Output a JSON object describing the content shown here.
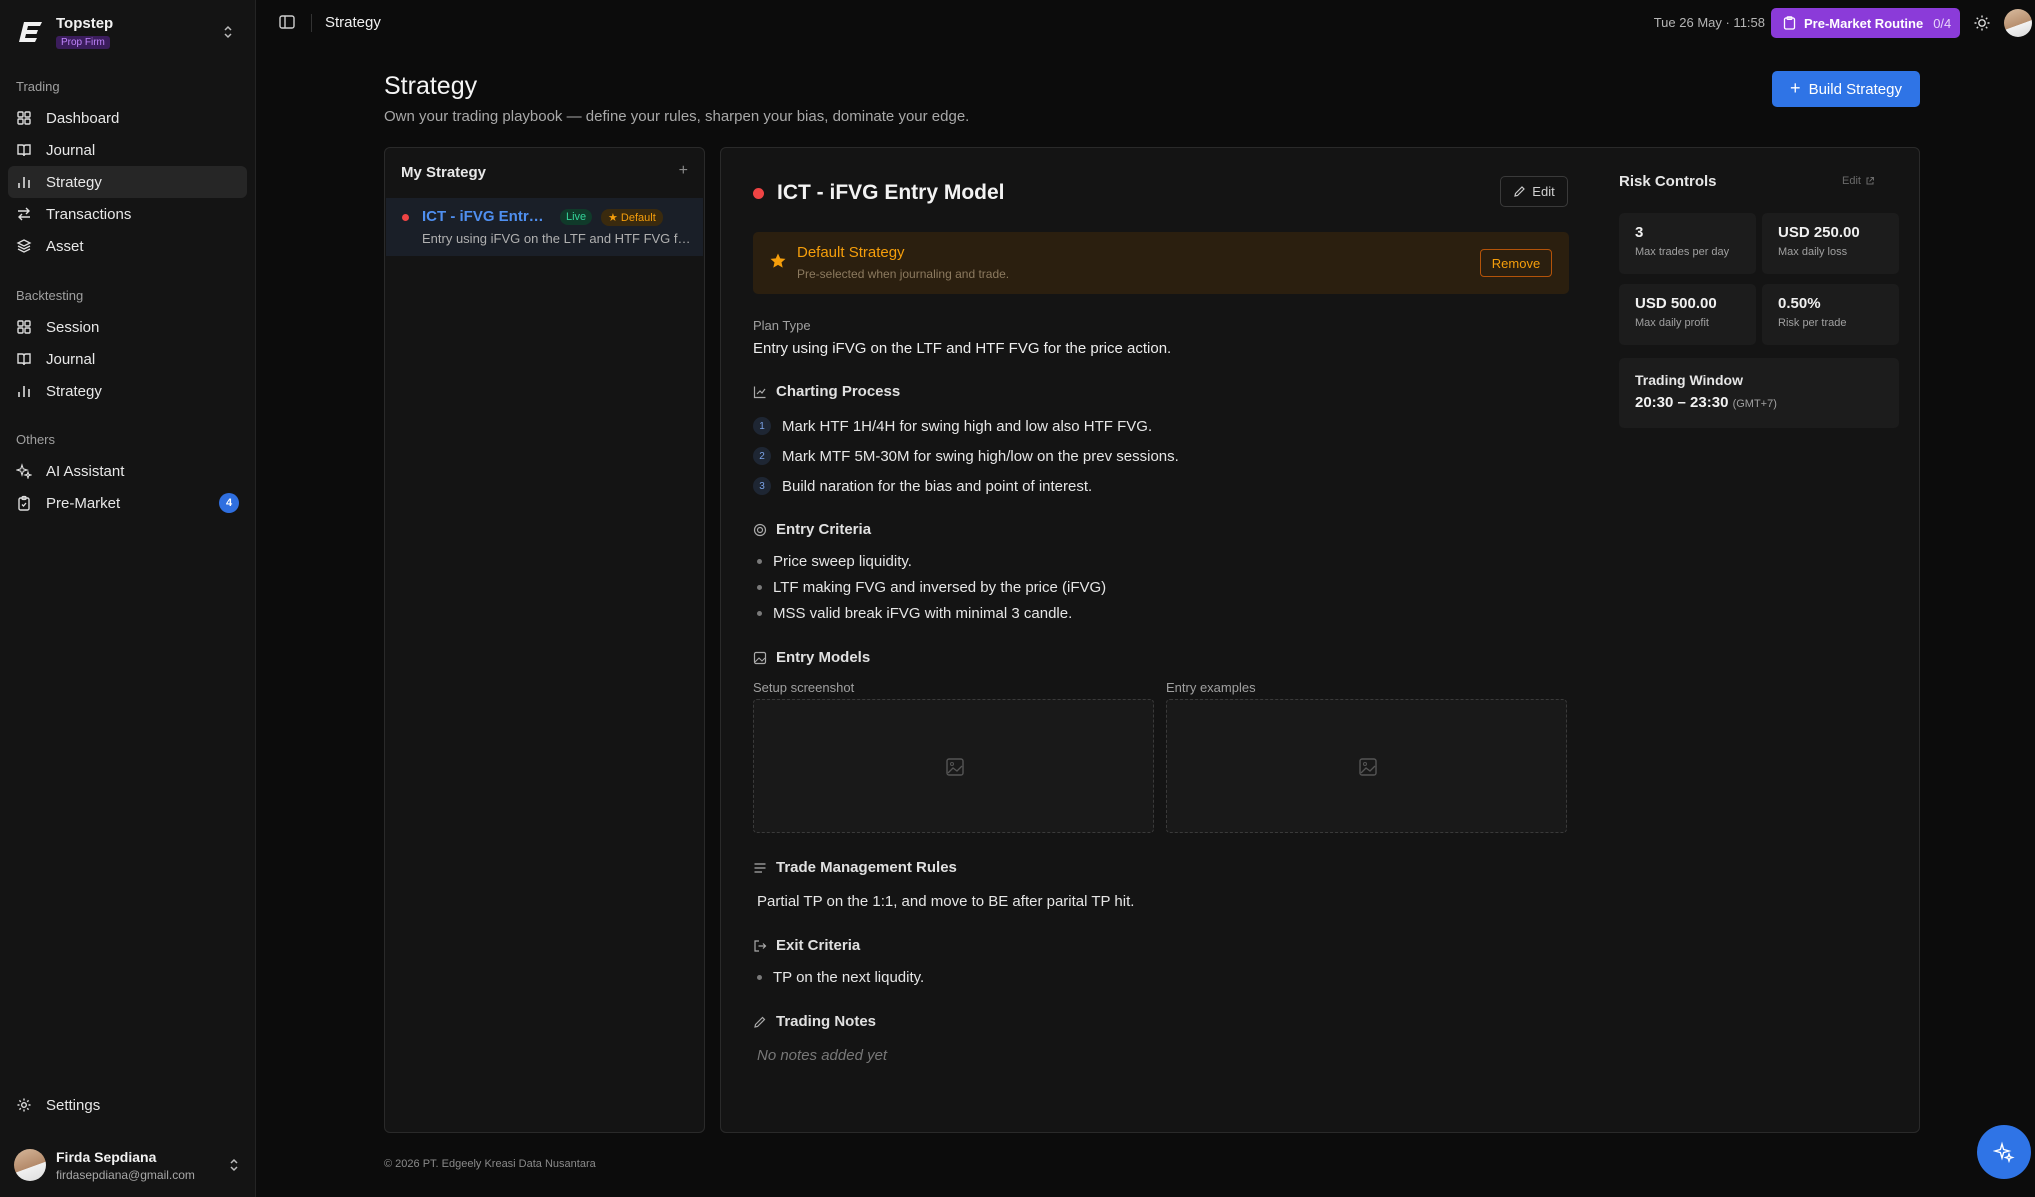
{
  "brand": {
    "name": "Topstep",
    "badge": "Prop Firm"
  },
  "sidebar": {
    "sections": [
      {
        "title": "Trading",
        "items": [
          {
            "label": "Dashboard",
            "icon": "grid-icon"
          },
          {
            "label": "Journal",
            "icon": "book-icon"
          },
          {
            "label": "Strategy",
            "icon": "bar-chart-icon",
            "active": true
          },
          {
            "label": "Transactions",
            "icon": "arrows-icon"
          },
          {
            "label": "Asset",
            "icon": "layers-icon"
          }
        ]
      },
      {
        "title": "Backtesting",
        "items": [
          {
            "label": "Session",
            "icon": "grid-icon"
          },
          {
            "label": "Journal",
            "icon": "book-icon"
          },
          {
            "label": "Strategy",
            "icon": "bar-chart-icon"
          }
        ]
      },
      {
        "title": "Others",
        "items": [
          {
            "label": "AI Assistant",
            "icon": "sparkles-icon"
          },
          {
            "label": "Pre-Market",
            "icon": "clipboard-icon",
            "count": "4"
          }
        ]
      }
    ],
    "settings_label": "Settings",
    "user": {
      "name": "Firda Sepdiana",
      "email": "firdasepdiana@gmail.com"
    }
  },
  "topbar": {
    "breadcrumb": "Strategy",
    "datetime": "Tue 26 May · 11:58",
    "routine_label": "Pre-Market Routine",
    "routine_count": "0/4"
  },
  "page": {
    "title": "Strategy",
    "subtitle": "Own your trading playbook — define your rules, sharpen your bias, dominate your edge.",
    "build_button": "Build Strategy"
  },
  "my_strategy": {
    "header": "My Strategy",
    "add": "+",
    "items": [
      {
        "title": "ICT - iFVG Entry Model",
        "live": "Live",
        "default": "Default",
        "description": "Entry using iFVG on the LTF and HTF FVG for the price action."
      }
    ]
  },
  "detail": {
    "title": "ICT - iFVG Entry Model",
    "edit": "Edit",
    "default_box": {
      "title": "Default Strategy",
      "subtitle": "Pre-selected when journaling and trade.",
      "remove": "Remove"
    },
    "plan_type_label": "Plan Type",
    "plan_type": "Entry using iFVG on the LTF and HTF FVG for the price action.",
    "charting": {
      "title": "Charting Process",
      "steps": [
        {
          "n": "1",
          "text": "Mark HTF 1H/4H for swing high and low also HTF FVG."
        },
        {
          "n": "2",
          "text": "Mark MTF 5M-30M for swing high/low on the prev sessions."
        },
        {
          "n": "3",
          "text": "Build naration for the bias and point of interest."
        }
      ]
    },
    "entry_criteria": {
      "title": "Entry Criteria",
      "items": [
        "Price sweep liquidity.",
        "LTF making FVG and inversed by the price (iFVG)",
        "MSS valid break iFVG with minimal 3 candle."
      ]
    },
    "entry_models": {
      "title": "Entry Models",
      "setup_label": "Setup screenshot",
      "examples_label": "Entry examples"
    },
    "trade_mgmt": {
      "title": "Trade Management Rules",
      "text": "Partial TP on the 1:1, and move to BE after parital TP hit."
    },
    "exit": {
      "title": "Exit Criteria",
      "items": [
        "TP on the next liqudity."
      ]
    },
    "notes": {
      "title": "Trading Notes",
      "empty": "No notes added yet"
    }
  },
  "risk": {
    "title": "Risk Controls",
    "edit": "Edit",
    "cards": [
      {
        "value": "3",
        "label": "Max trades per day"
      },
      {
        "value": "USD 250.00",
        "label": "Max daily loss"
      },
      {
        "value": "USD 500.00",
        "label": "Max daily profit"
      },
      {
        "value": "0.50%",
        "label": "Risk per trade"
      }
    ],
    "window": {
      "title": "Trading Window",
      "time": "20:30 – 23:30",
      "tz": "(GMT+7)"
    }
  },
  "footer": "© 2026 PT. Edgeely Kreasi Data Nusantara",
  "colors": {
    "accent": "#2f74e6",
    "routine": "#8b3bd9",
    "default": "#f59e0b",
    "live": "#34d399",
    "danger": "#ef4444"
  }
}
